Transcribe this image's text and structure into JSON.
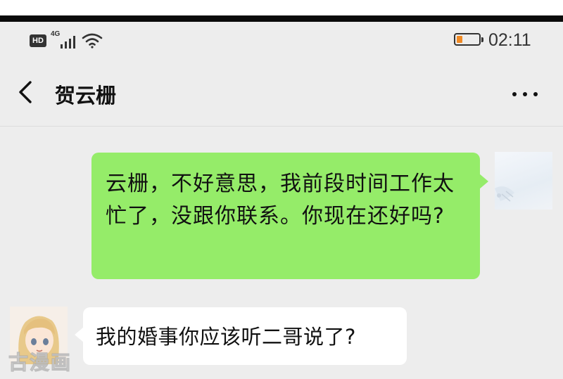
{
  "status_bar": {
    "hd_label": "HD",
    "network_type": "4G",
    "time": "02:11",
    "battery_level": 0.25,
    "battery_color": "#f08a24"
  },
  "header": {
    "back_icon": "chevron-left-icon",
    "title": "贺云栅",
    "more_icon": "more-dots-icon"
  },
  "messages": [
    {
      "direction": "outgoing",
      "text": "云栅，不好意思，我前段时间工作太忙了，没跟你联系。你现在还好吗?",
      "bubble_color": "#95ec69"
    },
    {
      "direction": "incoming",
      "text": "我的婚事你应该听二哥说了?",
      "bubble_color": "#ffffff"
    }
  ],
  "watermark": "古漫画",
  "colors": {
    "background": "#ededed",
    "outgoing_bubble": "#95ec69",
    "incoming_bubble": "#ffffff"
  }
}
